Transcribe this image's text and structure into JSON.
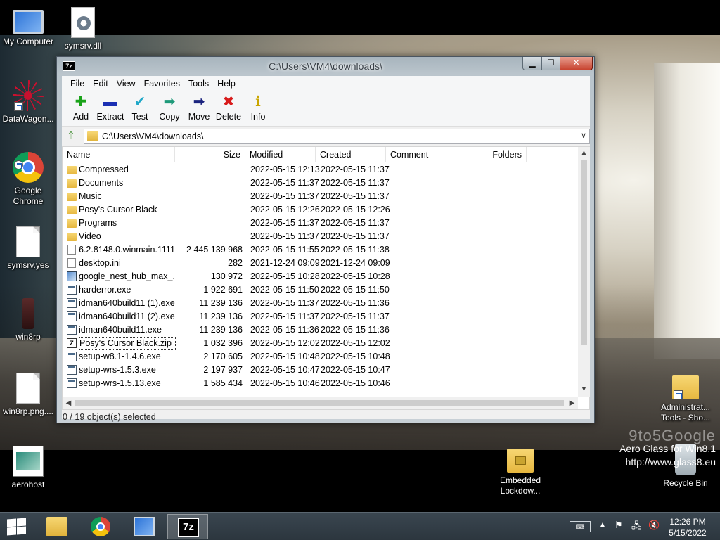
{
  "desktop": {
    "icons_left": [
      {
        "label": "My Computer",
        "icon": "my-computer-icon"
      },
      {
        "label": "DataWagon...",
        "icon": "datawagon-icon"
      },
      {
        "label": "Google Chrome",
        "icon": "chrome-icon"
      },
      {
        "label": "symsrv.yes",
        "icon": "document-icon"
      },
      {
        "label": "win8rp",
        "icon": "win8rp-icon"
      },
      {
        "label": "win8rp.png....",
        "icon": "document-icon"
      },
      {
        "label": "aerohost",
        "icon": "aerohost-icon"
      }
    ],
    "icon_symsrv_dll": "symsrv.dll",
    "icon_admin_tools": "Administrat... Tools - Sho...",
    "icon_embedded_lockdown": "Embedded Lockdow...",
    "icon_recycle_bin": "Recycle Bin",
    "watermark": {
      "brand": "9to5Google",
      "line1": "Aero Glass for Win8.1",
      "line2": "http://www.glass8.eu"
    }
  },
  "window": {
    "title": "C:\\Users\\VM4\\downloads\\",
    "app_icon_text": "7z",
    "controls": {
      "minimize": "▁",
      "maximize": "☐",
      "close": "✕"
    },
    "menu": [
      "File",
      "Edit",
      "View",
      "Favorites",
      "Tools",
      "Help"
    ],
    "toolbar": [
      {
        "label": "Add",
        "icon": "add-icon",
        "glyph": "✚",
        "color": "#1aa31a"
      },
      {
        "label": "Extract",
        "icon": "extract-icon",
        "glyph": "▬",
        "color": "#1a2fb3"
      },
      {
        "label": "Test",
        "icon": "test-icon",
        "glyph": "✔",
        "color": "#20a8c8"
      },
      {
        "label": "Copy",
        "icon": "copy-icon",
        "glyph": "➡",
        "color": "#1e9a7a"
      },
      {
        "label": "Move",
        "icon": "move-icon",
        "glyph": "➡",
        "color": "#1a237e"
      },
      {
        "label": "Delete",
        "icon": "delete-icon",
        "glyph": "✖",
        "color": "#d81b1b"
      },
      {
        "label": "Info",
        "icon": "info-icon",
        "glyph": "ℹ",
        "color": "#c9a500"
      }
    ],
    "address": "C:\\Users\\VM4\\downloads\\",
    "columns": {
      "name": "Name",
      "size": "Size",
      "modified": "Modified",
      "created": "Created",
      "comment": "Comment",
      "folders": "Folders"
    },
    "files": [
      {
        "name": "Compressed",
        "size": "",
        "modified": "2022-05-15 12:13",
        "created": "2022-05-15 11:37",
        "type": "folder"
      },
      {
        "name": "Documents",
        "size": "",
        "modified": "2022-05-15 11:37",
        "created": "2022-05-15 11:37",
        "type": "folder"
      },
      {
        "name": "Music",
        "size": "",
        "modified": "2022-05-15 11:37",
        "created": "2022-05-15 11:37",
        "type": "folder"
      },
      {
        "name": "Posy's Cursor Black",
        "size": "",
        "modified": "2022-05-15 12:26",
        "created": "2022-05-15 12:26",
        "type": "folder"
      },
      {
        "name": "Programs",
        "size": "",
        "modified": "2022-05-15 11:37",
        "created": "2022-05-15 11:37",
        "type": "folder"
      },
      {
        "name": "Video",
        "size": "",
        "modified": "2022-05-15 11:37",
        "created": "2022-05-15 11:37",
        "type": "folder"
      },
      {
        "name": "6.2.8148.0.winmain.1111...",
        "size": "2 445 139 968",
        "modified": "2022-05-15 11:55",
        "created": "2022-05-15 11:38",
        "type": "file"
      },
      {
        "name": "desktop.ini",
        "size": "282",
        "modified": "2021-12-24 09:09",
        "created": "2021-12-24 09:09",
        "type": "file"
      },
      {
        "name": "google_nest_hub_max_...",
        "size": "130 972",
        "modified": "2022-05-15 10:28",
        "created": "2022-05-15 10:28",
        "type": "image"
      },
      {
        "name": "harderror.exe",
        "size": "1 922 691",
        "modified": "2022-05-15 11:50",
        "created": "2022-05-15 11:50",
        "type": "exe"
      },
      {
        "name": "idman640build11 (1).exe",
        "size": "11 239 136",
        "modified": "2022-05-15 11:37",
        "created": "2022-05-15 11:36",
        "type": "exe"
      },
      {
        "name": "idman640build11 (2).exe",
        "size": "11 239 136",
        "modified": "2022-05-15 11:37",
        "created": "2022-05-15 11:37",
        "type": "exe"
      },
      {
        "name": "idman640build11.exe",
        "size": "11 239 136",
        "modified": "2022-05-15 11:36",
        "created": "2022-05-15 11:36",
        "type": "exe"
      },
      {
        "name": "Posy's Cursor Black.zip",
        "size": "1 032 396",
        "modified": "2022-05-15 12:02",
        "created": "2022-05-15 12:02",
        "type": "zip",
        "focused": true
      },
      {
        "name": "setup-w8.1-1.4.6.exe",
        "size": "2 170 605",
        "modified": "2022-05-15 10:48",
        "created": "2022-05-15 10:48",
        "type": "exe"
      },
      {
        "name": "setup-wrs-1.5.3.exe",
        "size": "2 197 937",
        "modified": "2022-05-15 10:47",
        "created": "2022-05-15 10:47",
        "type": "exe"
      },
      {
        "name": "setup-wrs-1.5.13.exe",
        "size": "1 585 434",
        "modified": "2022-05-15 10:46",
        "created": "2022-05-15 10:46",
        "type": "exe"
      }
    ],
    "status": "0 / 19 object(s) selected"
  },
  "taskbar": {
    "apps": [
      {
        "name": "file-explorer",
        "icon": "file-explorer-icon",
        "active": false
      },
      {
        "name": "chrome",
        "icon": "chrome-icon",
        "active": false
      },
      {
        "name": "remote-desktop",
        "icon": "remote-desktop-icon",
        "active": false
      },
      {
        "name": "7zip",
        "icon": "seven-zip-icon",
        "label": "7z",
        "active": true
      }
    ],
    "clock_time": "12:26 PM",
    "clock_date": "5/15/2022"
  },
  "colors": {
    "taskbar": "#2c363e",
    "window_frame": "#b9c4cc",
    "close_button": "#c7432f"
  }
}
